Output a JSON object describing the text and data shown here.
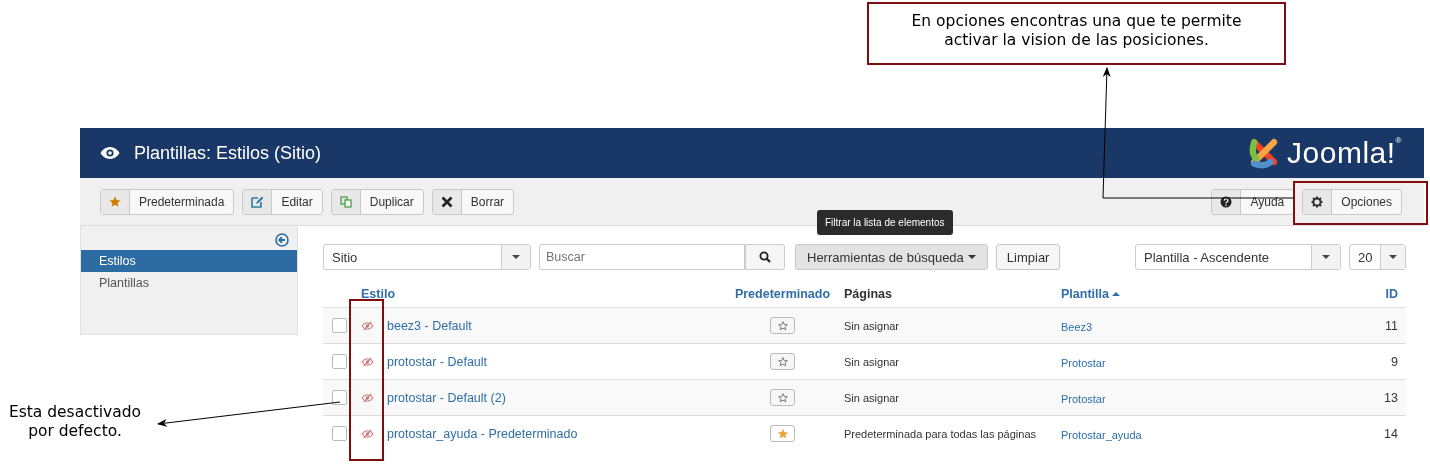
{
  "annotations": [
    {
      "text": "En opciones encontras una que te permite activar la vision de las posiciones."
    },
    {
      "text": "Esta desactivado por defecto."
    }
  ],
  "header": {
    "title": "Plantillas: Estilos (Sitio)",
    "logo": "Joomla!$^{®}$"
  },
  "toolbar": {
    "left": [
      {
        "label": "Predeterminada",
        "kind": "star"
      },
      {
        "label": "Editar",
        "kind": "edit"
      },
      {
        "label": "Duplicar",
        "kind": "copy"
      },
      {
        "label": "Borrar",
        "kind": "delete"
      }
    ],
    "right": [
      {
        "label": "Ayuda",
        "kind": "help"
      },
      {
        "label": "Opciones",
        "kind": "gear"
      }
    ]
  },
  "sidebar": {
    "items": [
      {
        "label": "Estilos",
        "selected": true
      },
      {
        "label": "Plantillas",
        "selected": false
      }
    ]
  },
  "filters": {
    "client": "Sitio",
    "search": {
      "placeholder": "Buscar"
    },
    "tools": "Herramientas de búsqueda",
    "clear": "Limpiar",
    "tooltip": "Filtrar la lista de elementos",
    "sort": "Plantilla - Ascendente",
    "limit": "20"
  },
  "table": {
    "columns": [
      {
        "label": "Estilo",
        "link": true,
        "sorted": false
      },
      {
        "label": "Predeterminado",
        "link": true,
        "sorted": false
      },
      {
        "label": "Páginas",
        "link": false,
        "sorted": false
      },
      {
        "label": "Plantilla",
        "link": true,
        "sorted": true
      },
      {
        "label": "ID",
        "link": true,
        "sorted": false
      }
    ],
    "rows": [
      {
        "name": "beez3 - Default",
        "checked": false,
        "default": false,
        "pages": "Sin asignar",
        "template": "Beez3",
        "id": "11"
      },
      {
        "name": "protostar - Default",
        "checked": false,
        "default": false,
        "pages": "Sin asignar",
        "template": "Protostar",
        "id": "9"
      },
      {
        "name": "protostar - Default (2)",
        "checked": false,
        "default": false,
        "pages": "Sin asignar",
        "template": "Protostar",
        "id": "13"
      },
      {
        "name": "protostar_ayuda - Predeterminado",
        "checked": false,
        "default": true,
        "pages": "Predeterminada para todas las páginas",
        "template": "Protostar_ayuda",
        "id": "14"
      }
    ]
  }
}
